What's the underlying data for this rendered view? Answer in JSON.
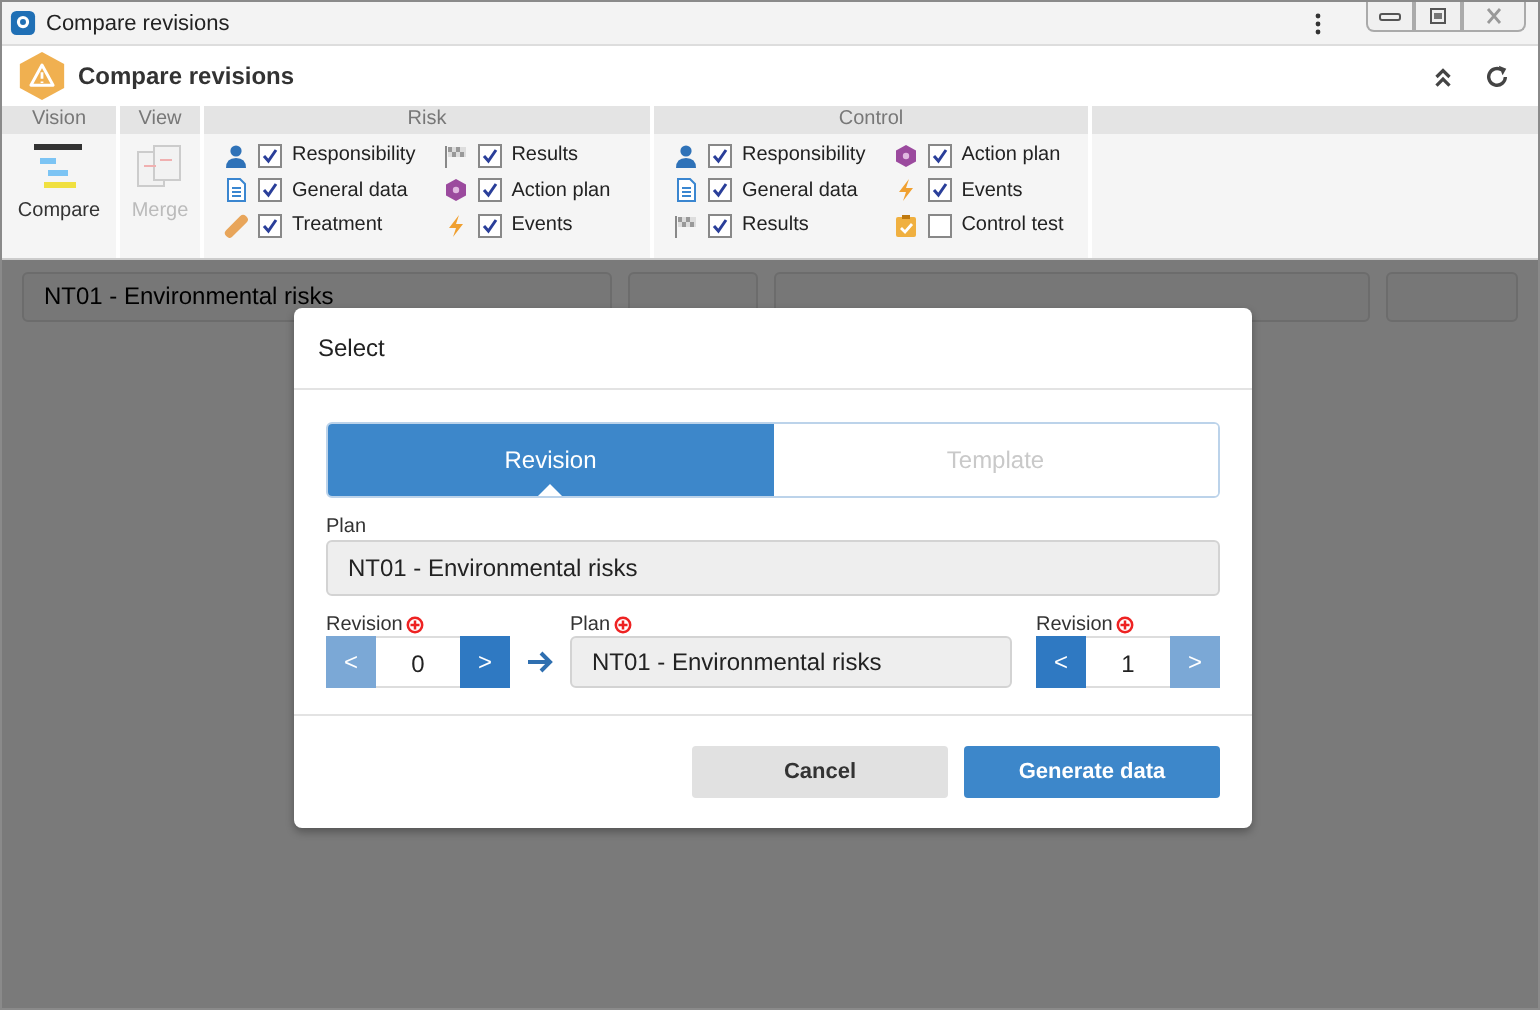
{
  "window": {
    "title": "Compare revisions"
  },
  "header": {
    "title": "Compare revisions"
  },
  "ribbon": {
    "groups": [
      {
        "title": "Vision",
        "kind": "button",
        "button": {
          "label": "Compare",
          "disabled": false
        }
      },
      {
        "title": "View",
        "kind": "button",
        "button": {
          "label": "Merge",
          "disabled": true
        }
      },
      {
        "title": "Risk",
        "kind": "options",
        "options": [
          {
            "label": "Responsibility",
            "checked": true
          },
          {
            "label": "General data",
            "checked": true
          },
          {
            "label": "Treatment",
            "checked": true
          },
          {
            "label": "Results",
            "checked": true
          },
          {
            "label": "Action plan",
            "checked": true
          },
          {
            "label": "Events",
            "checked": true
          }
        ]
      },
      {
        "title": "Control",
        "kind": "options",
        "options": [
          {
            "label": "Responsibility",
            "checked": true
          },
          {
            "label": "General data",
            "checked": true
          },
          {
            "label": "Results",
            "checked": true
          },
          {
            "label": "Action plan",
            "checked": true
          },
          {
            "label": "Events",
            "checked": true
          },
          {
            "label": "Control test",
            "checked": false
          }
        ]
      }
    ]
  },
  "filter_bar": {
    "plan": {
      "value": "NT01 - Environmental risks"
    }
  },
  "dialog": {
    "title": "Select",
    "tabs": [
      {
        "label": "Revision",
        "selected": true
      },
      {
        "label": "Template",
        "selected": false
      }
    ],
    "plan": {
      "label": "Plan",
      "value": "NT01 - Environmental risks"
    },
    "source_revision": {
      "label": "Revision",
      "required": true,
      "value": "0",
      "prev": {
        "label": "<",
        "disabled": true
      },
      "next": {
        "label": ">",
        "disabled": false
      }
    },
    "target_plan": {
      "label": "Plan",
      "required": true,
      "value": "NT01 - Environmental risks"
    },
    "target_revision": {
      "label": "Revision",
      "required": true,
      "value": "1",
      "prev": {
        "label": "<",
        "disabled": false
      },
      "next": {
        "label": ">",
        "disabled": true
      }
    },
    "buttons": [
      {
        "label": "Cancel",
        "kind": "secondary"
      },
      {
        "label": "Generate data",
        "kind": "primary"
      }
    ]
  }
}
